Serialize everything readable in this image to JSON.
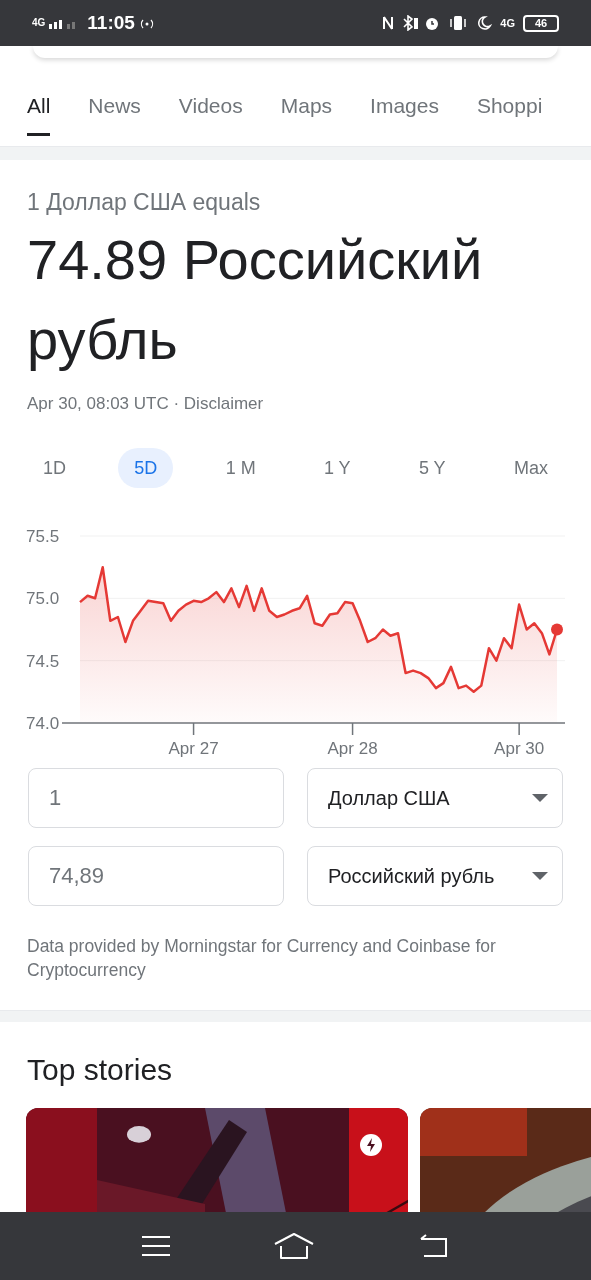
{
  "status_bar": {
    "network_left": "4G",
    "time": "11:05",
    "network_right": "4G",
    "battery": "46"
  },
  "tabs": [
    {
      "label": "All",
      "selected": true
    },
    {
      "label": "News",
      "selected": false
    },
    {
      "label": "Videos",
      "selected": false
    },
    {
      "label": "Maps",
      "selected": false
    },
    {
      "label": "Images",
      "selected": false
    },
    {
      "label": "Shoppi",
      "selected": false
    }
  ],
  "converter": {
    "equals_line": "1 Доллар США equals",
    "result": "74.89 Российский рубль",
    "timestamp": "Apr 30, 08:03 UTC · ",
    "disclaimer": "Disclaimer",
    "periods": [
      {
        "label": "1D",
        "selected": false
      },
      {
        "label": "5D",
        "selected": true
      },
      {
        "label": "1 M",
        "selected": false
      },
      {
        "label": "1 Y",
        "selected": false
      },
      {
        "label": "5 Y",
        "selected": false
      },
      {
        "label": "Max",
        "selected": false
      }
    ],
    "chart_data": {
      "type": "area",
      "categories": [
        null,
        null,
        null,
        null,
        null,
        null,
        null,
        null,
        null,
        null,
        null,
        null,
        null,
        null,
        null,
        "Apr 27",
        null,
        null,
        null,
        null,
        null,
        null,
        null,
        null,
        null,
        null,
        null,
        null,
        null,
        null,
        null,
        null,
        null,
        null,
        null,
        null,
        "Apr 28",
        null,
        null,
        null,
        null,
        null,
        null,
        null,
        null,
        null,
        null,
        null,
        null,
        null,
        null,
        null,
        null,
        null,
        null,
        null,
        null,
        null,
        "Apr 30",
        null,
        null,
        null,
        null,
        null
      ],
      "ylim": [
        74.0,
        75.5
      ],
      "yticks": [
        {
          "value": 74.0,
          "label": "74.0"
        },
        {
          "value": 74.5,
          "label": "74.5"
        },
        {
          "value": 75.0,
          "label": "75.0"
        },
        {
          "value": 75.5,
          "label": "75.5"
        }
      ],
      "series": [
        {
          "color": "#e53935",
          "values": [
            74.97,
            75.02,
            75.0,
            75.25,
            74.82,
            74.85,
            74.65,
            74.82,
            74.9,
            74.98,
            74.97,
            74.96,
            74.82,
            74.9,
            74.95,
            74.98,
            74.97,
            75.0,
            75.05,
            74.97,
            75.08,
            74.93,
            75.1,
            74.9,
            75.08,
            74.9,
            74.85,
            74.87,
            74.9,
            74.92,
            75.02,
            74.8,
            74.78,
            74.87,
            74.88,
            74.97,
            74.96,
            74.82,
            74.65,
            74.68,
            74.75,
            74.7,
            74.72,
            74.4,
            74.42,
            74.4,
            74.36,
            74.28,
            74.32,
            74.45,
            74.28,
            74.3,
            74.25,
            74.3,
            74.6,
            74.5,
            74.68,
            74.6,
            74.95,
            74.75,
            74.8,
            74.72,
            74.55,
            74.75
          ]
        }
      ]
    },
    "amount_from": "1",
    "amount_to": "74,89",
    "currency_from": "Доллар США",
    "currency_to": "Российский рубль",
    "source_note": "Data provided by Morningstar for Currency and Coinbase for Cryptocurrency"
  },
  "top_stories": {
    "title": "Top stories",
    "cards": [
      {
        "kind": "picture",
        "amp": true
      },
      {
        "kind": "picture"
      }
    ]
  }
}
